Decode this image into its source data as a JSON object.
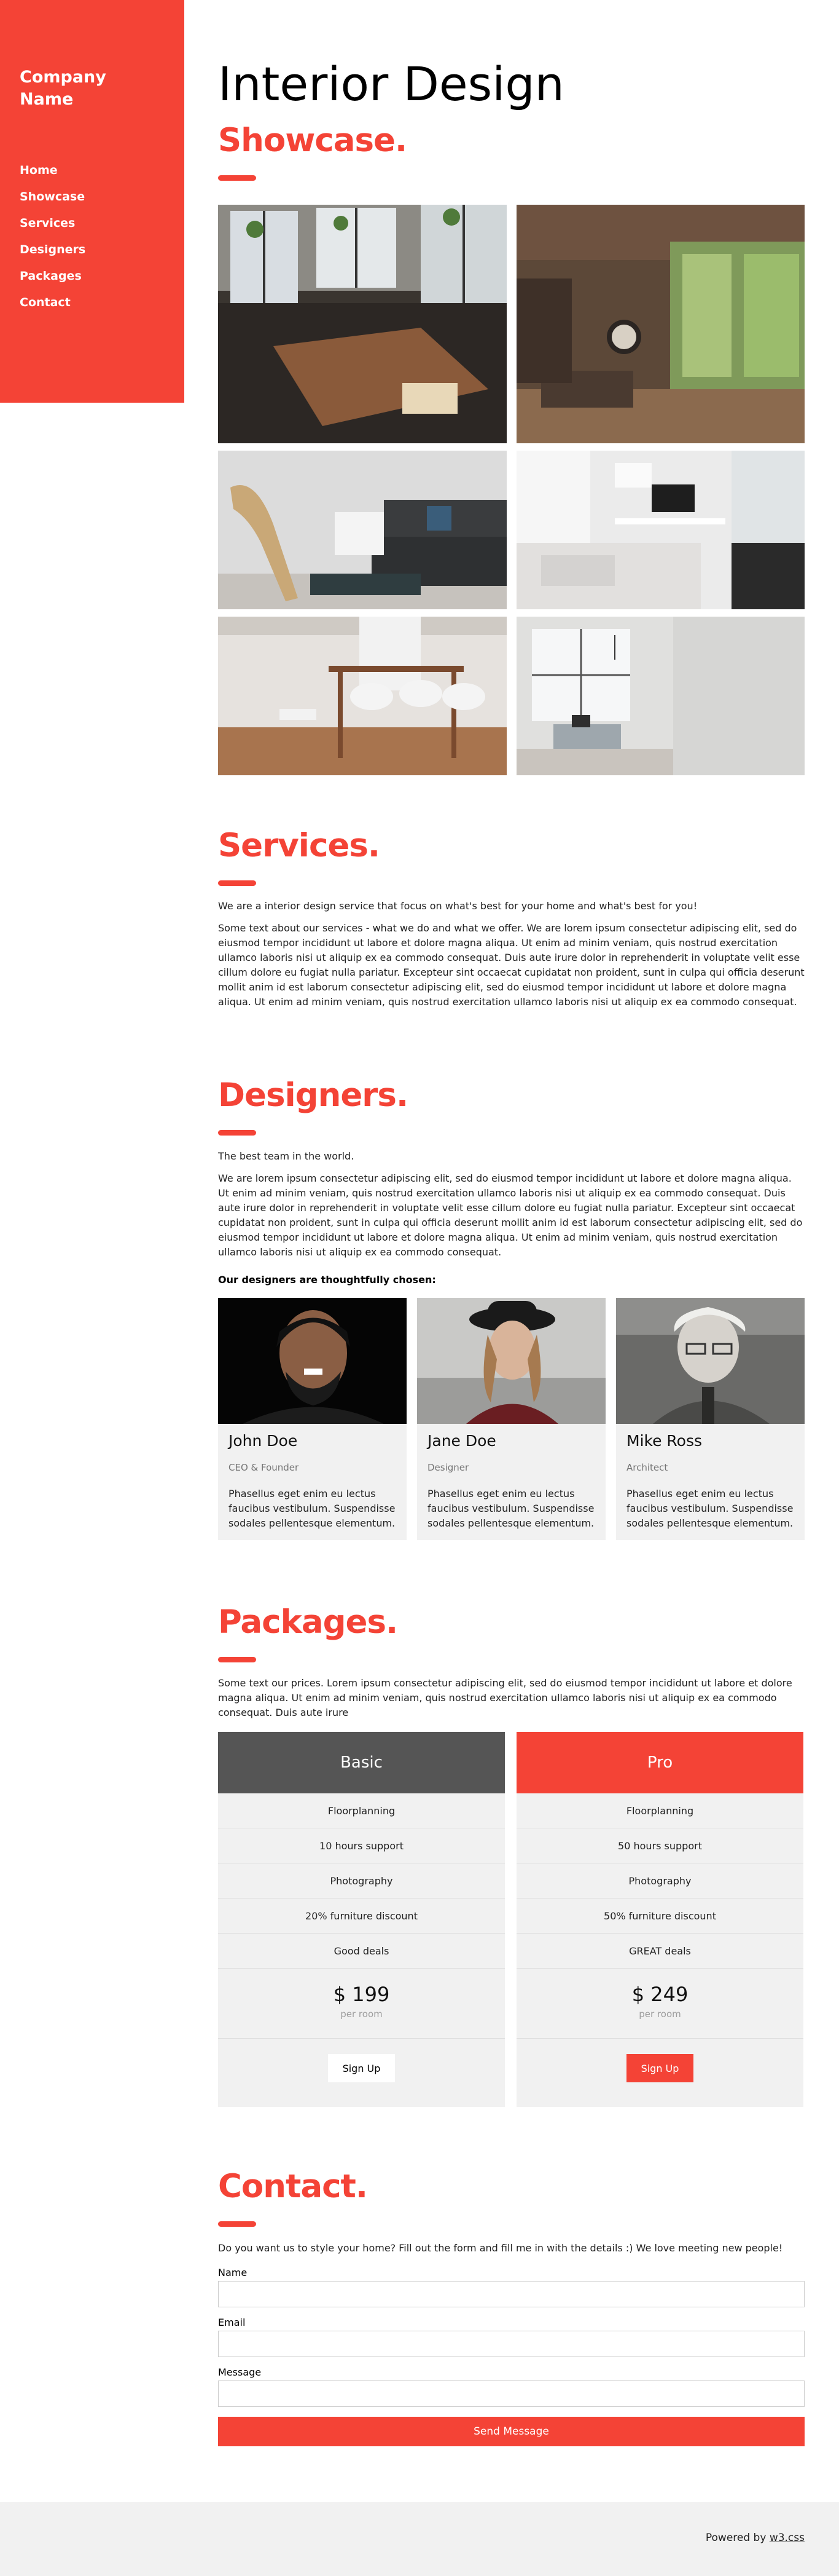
{
  "sidebar": {
    "brand": "Company Name",
    "nav": [
      "Home",
      "Showcase",
      "Services",
      "Designers",
      "Packages",
      "Contact"
    ]
  },
  "header": {
    "title": "Interior Design",
    "subtitle": "Showcase."
  },
  "services": {
    "title": "Services.",
    "intro": "We are a interior design service that focus on what's best for your home and what's best for you!",
    "body": "Some text about our services - what we do and what we offer. We are lorem ipsum consectetur adipiscing elit, sed do eiusmod tempor incididunt ut labore et dolore magna aliqua. Ut enim ad minim veniam, quis nostrud exercitation ullamco laboris nisi ut aliquip ex ea commodo consequat. Duis aute irure dolor in reprehenderit in voluptate velit esse cillum dolore eu fugiat nulla pariatur. Excepteur sint occaecat cupidatat non proident, sunt in culpa qui officia deserunt mollit anim id est laborum consectetur adipiscing elit, sed do eiusmod tempor incididunt ut labore et dolore magna aliqua. Ut enim ad minim veniam, quis nostrud exercitation ullamco laboris nisi ut aliquip ex ea commodo consequat."
  },
  "designers": {
    "title": "Designers.",
    "intro": "The best team in the world.",
    "body": "We are lorem ipsum consectetur adipiscing elit, sed do eiusmod tempor incididunt ut labore et dolore magna aliqua. Ut enim ad minim veniam, quis nostrud exercitation ullamco laboris nisi ut aliquip ex ea commodo consequat. Duis aute irure dolor in reprehenderit in voluptate velit esse cillum dolore eu fugiat nulla pariatur. Excepteur sint occaecat cupidatat non proident, sunt in culpa qui officia deserunt mollit anim id est laborum consectetur adipiscing elit, sed do eiusmod tempor incididunt ut labore et dolore magna aliqua. Ut enim ad minim veniam, quis nostrud exercitation ullamco laboris nisi ut aliquip ex ea commodo consequat.",
    "lead": "Our designers are thoughtfully chosen:",
    "cards": [
      {
        "name": "John Doe",
        "role": "CEO & Founder",
        "text": "Phasellus eget enim eu lectus faucibus vestibulum. Suspendisse sodales pellentesque elementum."
      },
      {
        "name": "Jane Doe",
        "role": "Designer",
        "text": "Phasellus eget enim eu lectus faucibus vestibulum. Suspendisse sodales pellentesque elementum."
      },
      {
        "name": "Mike Ross",
        "role": "Architect",
        "text": "Phasellus eget enim eu lectus faucibus vestibulum. Suspendisse sodales pellentesque elementum."
      }
    ]
  },
  "packages": {
    "title": "Packages.",
    "intro": "Some text our prices. Lorem ipsum consectetur adipiscing elit, sed do eiusmod tempor incididunt ut labore et dolore magna aliqua. Ut enim ad minim veniam, quis nostrud exercitation ullamco laboris nisi ut aliquip ex ea commodo consequat. Duis aute irure",
    "plans": [
      {
        "name": "Basic",
        "features": [
          "Floorplanning",
          "10 hours support",
          "Photography",
          "20% furniture discount",
          "Good deals"
        ],
        "price": "$ 199",
        "period": "per room",
        "cta": "Sign Up"
      },
      {
        "name": "Pro",
        "features": [
          "Floorplanning",
          "50 hours support",
          "Photography",
          "50% furniture discount",
          "GREAT deals"
        ],
        "price": "$ 249",
        "period": "per room",
        "cta": "Sign Up"
      }
    ]
  },
  "contact": {
    "title": "Contact.",
    "intro": "Do you want us to style your home? Fill out the form and fill me in with the details :) We love meeting new people!",
    "name_label": "Name",
    "email_label": "Email",
    "message_label": "Message",
    "submit": "Send Message"
  },
  "footer": {
    "text": "Powered by",
    "link": "w3.css"
  },
  "colors": {
    "accent": "#f44336",
    "dark_header": "#555555",
    "panel": "#f1f1f1"
  }
}
